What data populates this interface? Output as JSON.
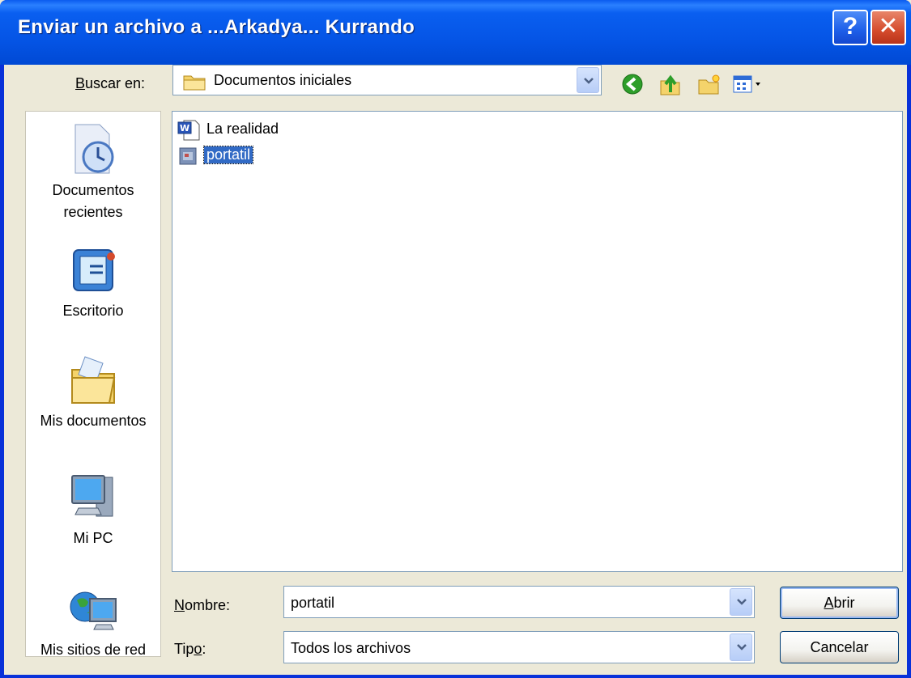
{
  "window": {
    "title": "Enviar un archivo a ...Arkadya... Kurrando"
  },
  "lookin": {
    "label_accel": "B",
    "label_rest": "uscar en:",
    "value": "Documentos iniciales"
  },
  "places": [
    {
      "label1": "Documentos",
      "label2": "recientes"
    },
    {
      "label1": "Escritorio",
      "label2": ""
    },
    {
      "label1": "Mis documentos",
      "label2": ""
    },
    {
      "label1": "Mi PC",
      "label2": ""
    },
    {
      "label1": "Mis sitios de red",
      "label2": ""
    }
  ],
  "files": [
    {
      "name": "La realidad",
      "icon": "word-document-icon",
      "selected": false
    },
    {
      "name": "portatil",
      "icon": "file-icon",
      "selected": true
    }
  ],
  "filename": {
    "label_accel": "N",
    "label_rest": "ombre:",
    "value": "portatil"
  },
  "filetype": {
    "label_pre": "Tip",
    "label_accel": "o",
    "label_rest": ":",
    "value": "Todos los archivos"
  },
  "buttons": {
    "open_accel": "A",
    "open_rest": "brir",
    "cancel": "Cancelar"
  },
  "colors": {
    "titlebar": "#0a5ff0",
    "selection": "#316ac5",
    "dialog": "#ece9d8"
  }
}
